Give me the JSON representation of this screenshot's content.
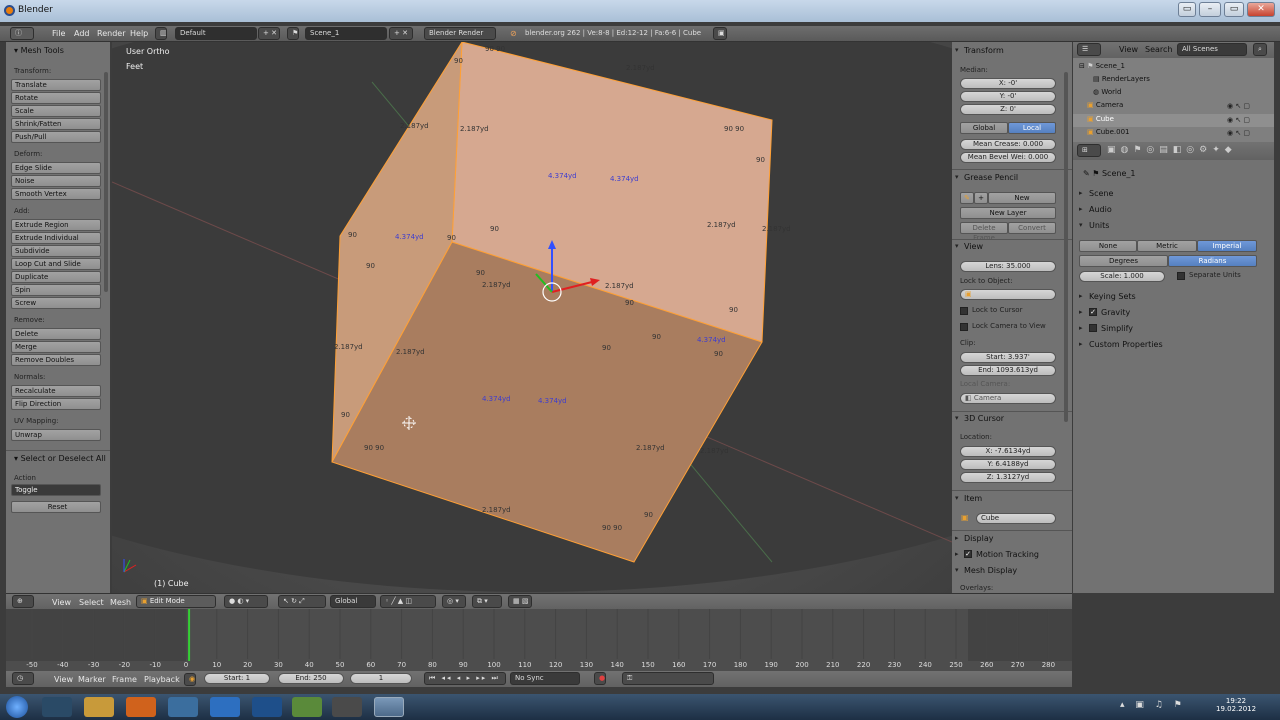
{
  "window": {
    "title": "Blender",
    "min": "–",
    "max": "▭",
    "close": "✕"
  },
  "header": {
    "menu": [
      "File",
      "Add",
      "Render",
      "Help"
    ],
    "screen": "Default",
    "scene": "Scene_1",
    "engine": "Blender Render",
    "stats": "blender.org 262 | Ve:8-8 | Ed:12-12 | Fa:6-6 | Cube"
  },
  "toolshelf": {
    "title": "Mesh Tools",
    "transform_label": "Transform:",
    "transform": [
      "Translate",
      "Rotate",
      "Scale",
      "Shrink/Fatten",
      "Push/Pull"
    ],
    "deform_label": "Deform:",
    "deform": [
      "Edge Slide",
      "Noise",
      "Smooth Vertex"
    ],
    "add_label": "Add:",
    "add": [
      "Extrude Region",
      "Extrude Individual",
      "Subdivide",
      "Loop Cut and Slide",
      "Duplicate",
      "Spin",
      "Screw"
    ],
    "remove_label": "Remove:",
    "remove": [
      "Delete",
      "Merge",
      "Remove Doubles"
    ],
    "normals_label": "Normals:",
    "normals": [
      "Recalculate",
      "Flip Direction"
    ],
    "uv_label": "UV Mapping:",
    "uv": [
      "Unwrap"
    ],
    "op_title": "Select or Deselect All",
    "action_label": "Action",
    "action_value": "Toggle",
    "reset": "Reset"
  },
  "viewport": {
    "view_name": "User Ortho",
    "units": "Feet",
    "object_label": "(1) Cube",
    "measures": [
      {
        "t": "90 90"
      },
      {
        "t": "90"
      },
      {
        "t": "2.187yd"
      },
      {
        "t": "2.187yd"
      },
      {
        "t": "2.187yd"
      },
      {
        "t": "90 90"
      },
      {
        "t": "90"
      },
      {
        "t": "4.374yd"
      },
      {
        "t": "4.374yd"
      },
      {
        "t": "2.187yd"
      },
      {
        "t": "2.187yd"
      },
      {
        "t": "90"
      },
      {
        "t": "4.374yd"
      },
      {
        "t": "90"
      },
      {
        "t": "90"
      },
      {
        "t": "90"
      },
      {
        "t": "90"
      },
      {
        "t": "2.187yd"
      },
      {
        "t": "2.187yd"
      },
      {
        "t": "90"
      },
      {
        "t": "90"
      },
      {
        "t": "2.187yd"
      },
      {
        "t": "2.187yd"
      },
      {
        "t": "90"
      },
      {
        "t": "90"
      },
      {
        "t": "4.374yd"
      },
      {
        "t": "90"
      },
      {
        "t": "4.374yd"
      },
      {
        "t": "4.374yd"
      },
      {
        "t": "90"
      },
      {
        "t": "90 90"
      },
      {
        "t": "2.187yd"
      },
      {
        "t": "2.187yd"
      },
      {
        "t": "2.187yd"
      },
      {
        "t": "90"
      },
      {
        "t": "90 90"
      }
    ]
  },
  "npanel": {
    "transform": "Transform",
    "median": "Median:",
    "x": "X: -0'",
    "y": "Y: -0'",
    "z": "Z: 0'",
    "global": "Global",
    "local": "Local",
    "mean_crease": "Mean Crease: 0.000",
    "mean_bevel": "Mean Bevel Wei: 0.000",
    "grease_pencil": "Grease Pencil",
    "gp_new": "New",
    "gp_new_layer": "New Layer",
    "gp_delete_frame": "Delete Frame",
    "gp_convert": "Convert",
    "view": "View",
    "lens": "Lens: 35.000",
    "lock_to_object": "Lock to Object:",
    "lock_to_cursor": "Lock to Cursor",
    "lock_camera": "Lock Camera to View",
    "clip": "Clip:",
    "clip_start": "Start: 3.937'",
    "clip_end": "End: 1093.613yd",
    "local_camera": "Local Camera:",
    "camera": "Camera",
    "cursor3d": "3D Cursor",
    "location": "Location:",
    "cx": "X: -7.6134yd",
    "cy": "Y: 6.4188yd",
    "cz": "Z: 1.3127yd",
    "item": "Item",
    "item_name": "Cube",
    "display": "Display",
    "motion_tracking": "Motion Tracking",
    "mesh_display": "Mesh Display",
    "overlays": "Overlays:"
  },
  "outliner": {
    "view": "View",
    "search": "Search",
    "scenes": "All Scenes",
    "rows": [
      "Scene_1",
      "RenderLayers",
      "World",
      "Camera",
      "Cube",
      "Cube.001"
    ]
  },
  "properties": {
    "scene": "Scene_1",
    "sections": [
      "Scene",
      "Audio",
      "Units"
    ],
    "unit_none": "None",
    "unit_metric": "Metric",
    "unit_imperial": "Imperial",
    "degrees": "Degrees",
    "radians": "Radians",
    "scale": "Scale: 1.000",
    "separate_units": "Separate Units",
    "keying_sets": "Keying Sets",
    "gravity": "Gravity",
    "simplify": "Simplify",
    "custom_properties": "Custom Properties"
  },
  "view3d_header": {
    "menus": [
      "View",
      "Select",
      "Mesh"
    ],
    "mode": "Edit Mode",
    "orientation": "Global"
  },
  "timeline": {
    "ticks": [
      "-50",
      "-40",
      "-30",
      "-20",
      "-10",
      "0",
      "10",
      "20",
      "30",
      "40",
      "50",
      "60",
      "70",
      "80",
      "90",
      "100",
      "110",
      "120",
      "130",
      "140",
      "150",
      "160",
      "170",
      "180",
      "190",
      "200",
      "210",
      "220",
      "230",
      "240",
      "250",
      "260",
      "270",
      "280"
    ],
    "current_frame": 1
  },
  "timeline_header": {
    "menus": [
      "View",
      "Marker",
      "Frame",
      "Playback"
    ],
    "start": "Start: 1",
    "end": "End: 250",
    "frame": "1",
    "sync": "No Sync"
  },
  "taskbar": {
    "time": "19:22",
    "date": "19.02.2012"
  },
  "colors": {
    "accent": "#5580c0",
    "face": "#c89b7a",
    "edge": "#ffa035",
    "bg": "#4a4a4a"
  }
}
